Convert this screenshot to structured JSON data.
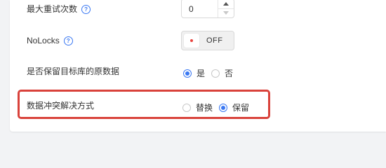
{
  "form": {
    "retry": {
      "label": "最大重试次数",
      "value": "0"
    },
    "nolocks": {
      "label": "NoLocks",
      "toggle_text": "OFF"
    },
    "keep_original": {
      "label": "是否保留目标库的原数据",
      "options": [
        {
          "label": "是",
          "checked": true
        },
        {
          "label": "否",
          "checked": false
        }
      ]
    },
    "conflict": {
      "label": "数据冲突解决方式",
      "options": [
        {
          "label": "替换",
          "checked": false
        },
        {
          "label": "保留",
          "checked": true
        }
      ]
    }
  },
  "icons": {
    "help": "?"
  },
  "colors": {
    "accent": "#3a78f2",
    "highlight_border": "#d9423b",
    "toggle_dot": "#e8423d",
    "background": "#f2f3f5"
  }
}
